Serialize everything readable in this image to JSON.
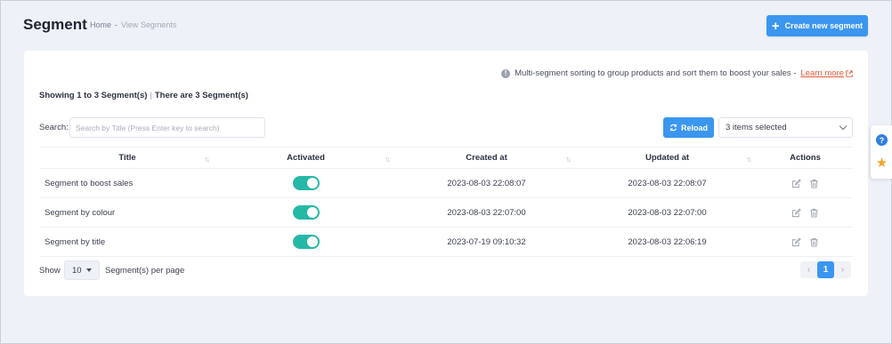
{
  "header": {
    "title": "Segment",
    "breadcrumb": {
      "home": "Home",
      "separator": "-",
      "current": "View Segments"
    },
    "create_button": "Create new segment"
  },
  "info": {
    "text": "Multi-segment sorting to group products and sort them to boost your sales -",
    "link": "Learn more"
  },
  "summary": {
    "showing": "Showing 1 to 3 Segment(s)",
    "separator": "|",
    "total": "There are 3 Segment(s)"
  },
  "search": {
    "label": "Search:",
    "placeholder": "Search by Title (Press Enter key to search)"
  },
  "reload_button": "Reload",
  "selection": "3 items selected",
  "table": {
    "columns": [
      "Title",
      "Activated",
      "Created at",
      "Updated at",
      "Actions"
    ],
    "rows": [
      {
        "title": "Segment to boost sales",
        "activated": true,
        "created": "2023-08-03 22:08:07",
        "updated": "2023-08-03 22:08:07"
      },
      {
        "title": "Segment by colour",
        "activated": true,
        "created": "2023-08-03 22:07:00",
        "updated": "2023-08-03 22:07:00"
      },
      {
        "title": "Segment by title",
        "activated": true,
        "created": "2023-07-19 09:10:32",
        "updated": "2023-08-03 22:06:19"
      }
    ]
  },
  "pagination": {
    "show_label": "Show",
    "per_page": "10",
    "per_page_label": "Segment(s) per page",
    "prev": "‹",
    "current_page": "1",
    "next": "›"
  },
  "colors": {
    "primary": "#3b96f0",
    "toggle_on": "#26b8a6",
    "link": "#e05a3a",
    "star": "#f2a62a"
  },
  "side_widget": {
    "icons": [
      "help-icon",
      "star-icon"
    ]
  }
}
